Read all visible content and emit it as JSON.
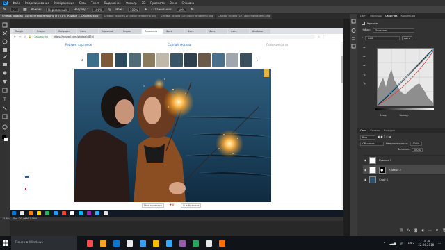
{
  "menubar": {
    "items": [
      "Файл",
      "Редактирование",
      "Изображение",
      "Слои",
      "Текст",
      "Выделение",
      "Фильтр",
      "3D",
      "Просмотр",
      "Окно",
      "Справка"
    ]
  },
  "options": {
    "mode_label": "Режим:",
    "mode_value": "Нормальный",
    "opacity_label": "Непрозр.:",
    "opacity_value": "100%",
    "flow_label": "Наж.:",
    "flow_value": "100%",
    "smooth_label": "Сглаживание:",
    "smooth_value": "10%"
  },
  "doc_tabs": [
    "Снимок экрана (174) восстановлено.png @ 75,8% (Кривые 3, Слой-маска/8)",
    "Снимок экрана (175) восстановлено.png",
    "Снимок экрана (176) восстановлено.png",
    "Снимок экрана (177) восстановлено.png"
  ],
  "browser": {
    "tabs": [
      "Google",
      "Яндекс",
      "Wallpaper",
      "Фото",
      "Картинки",
      "Яндекс",
      "Сохранено",
      "Фото",
      "Фото",
      "Фото",
      "Фото",
      "Альбомы",
      "Карта",
      "Фото",
      "Загрузки"
    ],
    "active_tab_index": 6,
    "url": "https://mywall.com/photos/4876/",
    "security": "Защищено",
    "site_left": "Рейтинг картинок",
    "site_center": "Сделай, москва",
    "site_right": "Похожие фото"
  },
  "thumbs": [
    "#3d6e8a",
    "#7a5a3a",
    "#2c4a5e",
    "#516b77",
    "#8a7b5c",
    "#c0b8a8",
    "#3a5566",
    "#2e3f4d",
    "#6b5a4a",
    "#4a6f8c",
    "#a0a6ad",
    "#3b4f5d"
  ],
  "photo_footer": {
    "like": "Мне нравится",
    "views": "♥ 87",
    "share": "В избранное"
  },
  "doc_taskbar_icons": [
    "#0078d7",
    "#e8e8e8",
    "#ff7f00",
    "#ffd400",
    "#1fb85a",
    "#2196f3",
    "#f44336",
    "#ffffff",
    "#00b4ff",
    "#9c27b0",
    "#31a8ff",
    "#e5e5e5"
  ],
  "status": {
    "zoom": "75,8%",
    "doc": "Док: 25,06M/1,29M"
  },
  "panels": {
    "top_tabs": [
      "Цвет",
      "Образцы",
      "Свойства",
      "Коррекция"
    ],
    "props_title": "Кривые",
    "preset_label": "Набор:",
    "preset_value": "Заказная",
    "channel_value": "RGB",
    "input_label": "Вход:",
    "output_label": "Выход:",
    "layer_tabs": [
      "Слои",
      "Каналы",
      "Контуры"
    ],
    "kind_label": "Вид",
    "blend_value": "Обычные",
    "opacity_label": "Непрозрачность:",
    "opacity_value": "100%",
    "fill_label": "Заливка:",
    "fill_value": "100%",
    "layers": [
      "Кривые 3",
      "Кривые 2",
      "Слой 0"
    ]
  },
  "taskbar": {
    "search_placeholder": "Поиск в Windows",
    "apps": [
      "#ff4a4a",
      "#f5a623",
      "#0078d7",
      "#e8e8e8",
      "#3c9af0",
      "#ffb900",
      "#31a8ff",
      "#9b59b6",
      "#26a65b",
      "#e6e6e6",
      "#ff6f00"
    ],
    "lang": "ENG",
    "time": "14:38",
    "date": "22.04.2018"
  }
}
